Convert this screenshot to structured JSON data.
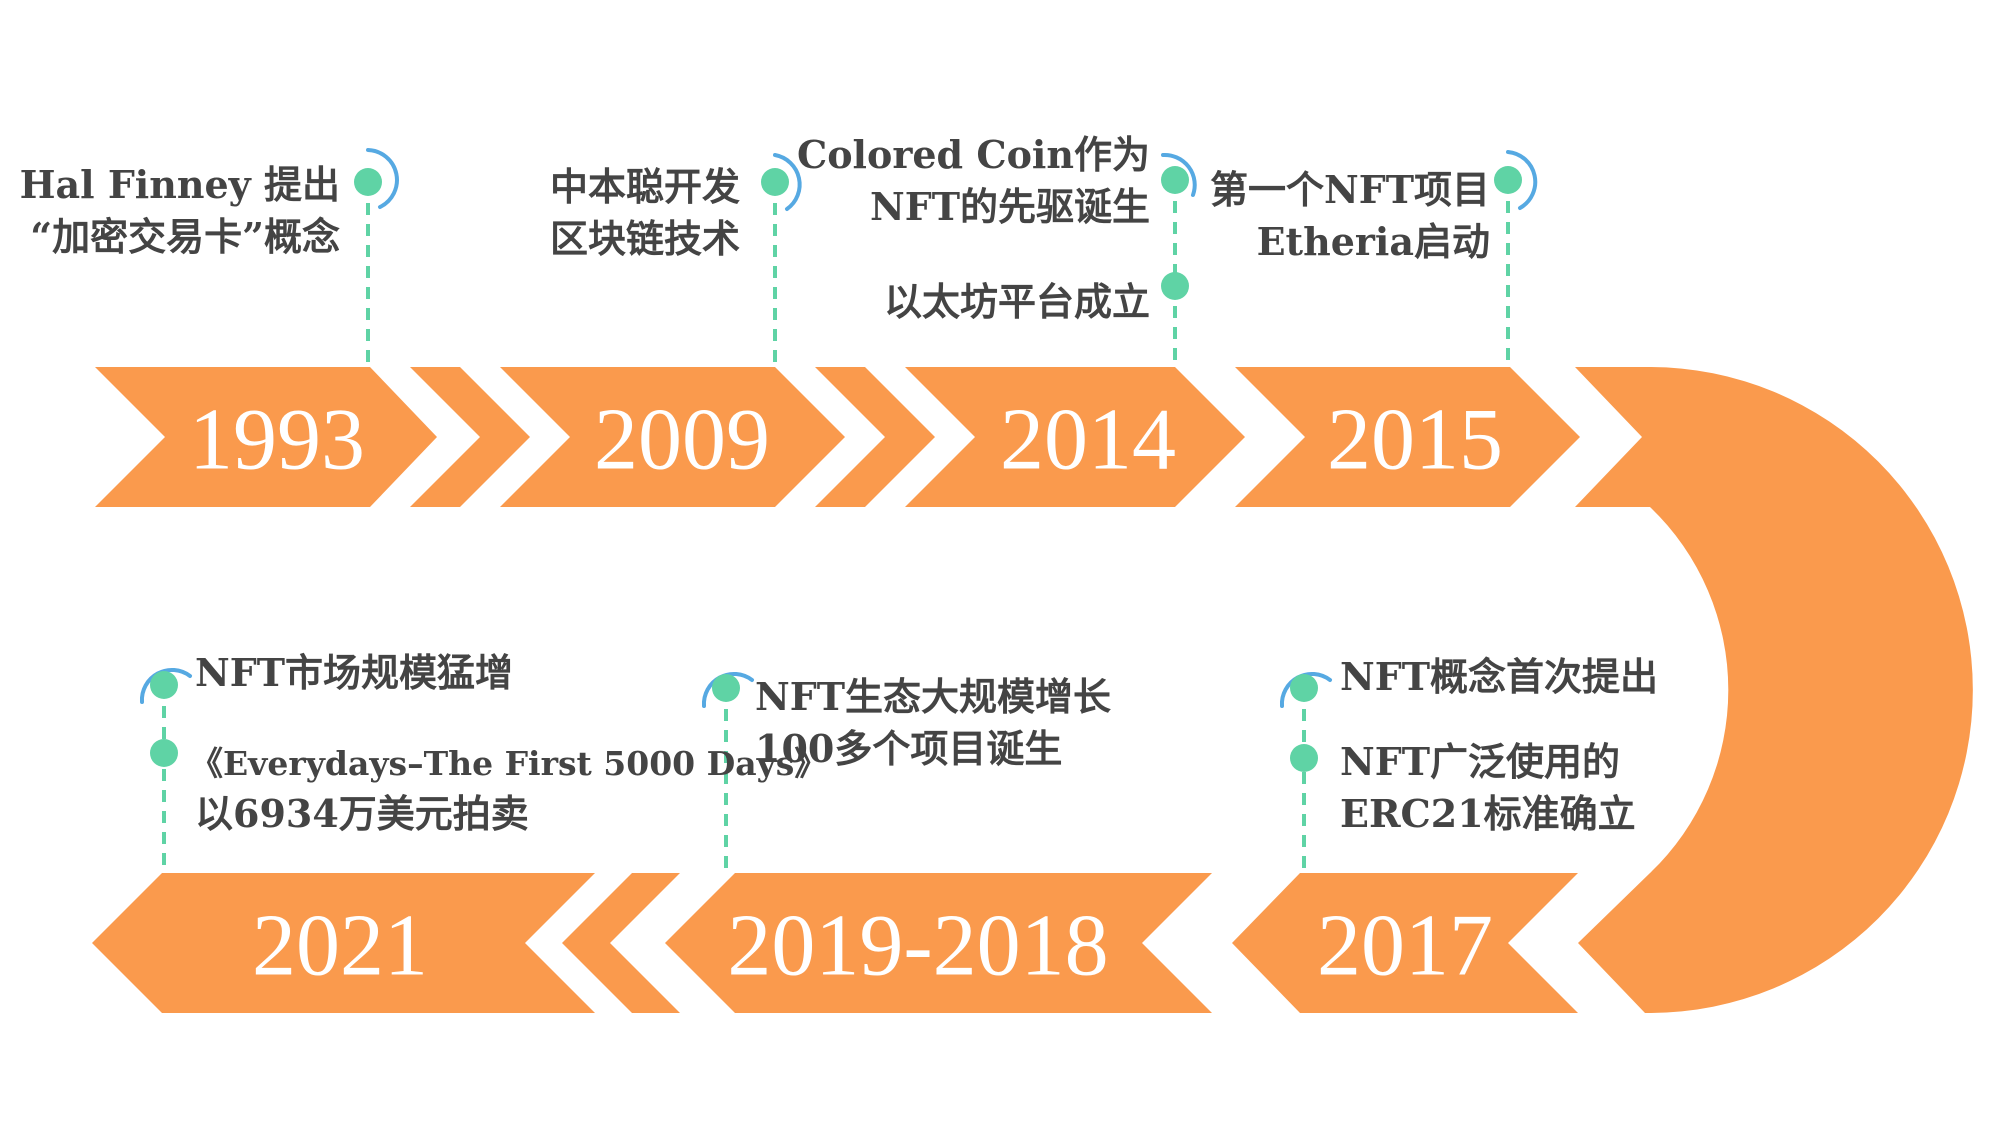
{
  "colors": {
    "arrow": "#fa9a4d",
    "connector": "#5fd3a5",
    "ring": "#56a9e2",
    "text": "#444444",
    "year_text": "#ffffff"
  },
  "top_row": [
    {
      "year": "1993",
      "events": [
        {
          "lines": [
            "Hal Finney 提出",
            "“加密交易卡”概念"
          ]
        }
      ]
    },
    {
      "year": "2009",
      "events": [
        {
          "lines": [
            "中本聪开发",
            "区块链技术"
          ]
        }
      ]
    },
    {
      "year": "2014",
      "events": [
        {
          "lines": [
            "Colored Coin作为",
            "NFT的先驱诞生"
          ]
        },
        {
          "lines": [
            "以太坊平台成立"
          ]
        }
      ]
    },
    {
      "year": "2015",
      "events": [
        {
          "lines": [
            "第一个NFT项目",
            "Etheria启动"
          ]
        }
      ]
    }
  ],
  "bottom_row": [
    {
      "year": "2017",
      "events": [
        {
          "lines": [
            "NFT概念首次提出"
          ]
        },
        {
          "lines": [
            "NFT广泛使用的",
            "ERC21标准确立"
          ]
        }
      ]
    },
    {
      "year": "2019-2018",
      "events": [
        {
          "lines": [
            "NFT生态大规模增长",
            "100多个项目诞生"
          ]
        }
      ]
    },
    {
      "year": "2021",
      "events": [
        {
          "lines": [
            "NFT市场规模猛增"
          ]
        },
        {
          "lines": [
            "《Everydays–The First 5000 Days》",
            "以6934万美元拍卖"
          ]
        }
      ]
    }
  ]
}
